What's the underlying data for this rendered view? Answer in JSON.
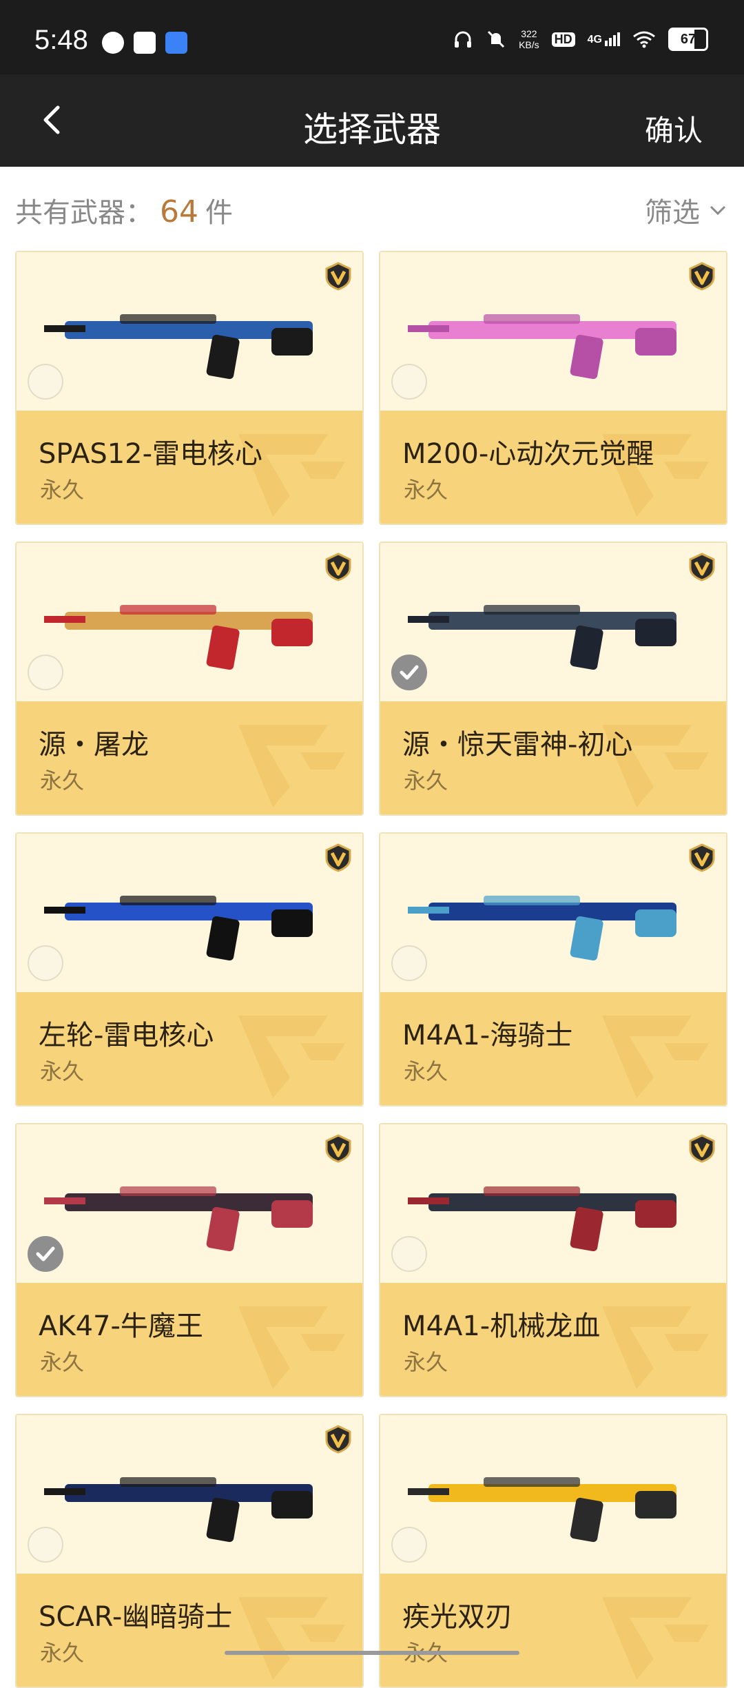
{
  "status_bar": {
    "time": "5:48",
    "speed_value": "322",
    "speed_unit": "KB/s",
    "hd": "HD",
    "network": "4G",
    "battery": "67",
    "left_icons": [
      "globe-icon",
      "app-icon",
      "app-icon"
    ],
    "right_icons": [
      "headphones-icon",
      "mute-icon",
      "hd-icon",
      "signal-icon",
      "wifi-icon",
      "battery-icon"
    ]
  },
  "header": {
    "title": "选择武器",
    "confirm_label": "确认",
    "back_icon": "chevron-left-icon"
  },
  "count_bar": {
    "prefix": "共有武器：",
    "count": "64",
    "unit": "件",
    "filter_label": "筛选",
    "filter_icon": "chevron-down-icon"
  },
  "colors": {
    "accent_count": "#b9793a",
    "card_top": "#fef7dd",
    "card_bottom": "#f7d47b",
    "header_bg": "#232323"
  },
  "weapons": [
    {
      "name": "SPAS12-雷电核心",
      "duration": "永久",
      "selected": false,
      "vip": true
    },
    {
      "name": "M200-心动次元觉醒",
      "duration": "永久",
      "selected": false,
      "vip": true
    },
    {
      "name": "源・屠龙",
      "duration": "永久",
      "selected": false,
      "vip": true
    },
    {
      "name": "源・惊天雷神-初心",
      "duration": "永久",
      "selected": true,
      "vip": true
    },
    {
      "name": "左轮-雷电核心",
      "duration": "永久",
      "selected": false,
      "vip": true
    },
    {
      "name": "M4A1-海骑士",
      "duration": "永久",
      "selected": false,
      "vip": true
    },
    {
      "name": "AK47-牛魔王",
      "duration": "永久",
      "selected": true,
      "vip": true
    },
    {
      "name": "M4A1-机械龙血",
      "duration": "永久",
      "selected": false,
      "vip": true
    },
    {
      "name": "SCAR-幽暗骑士",
      "duration": "永久",
      "selected": false,
      "vip": true
    },
    {
      "name": "疾光双刃",
      "duration": "永久",
      "selected": false,
      "vip": false
    }
  ]
}
